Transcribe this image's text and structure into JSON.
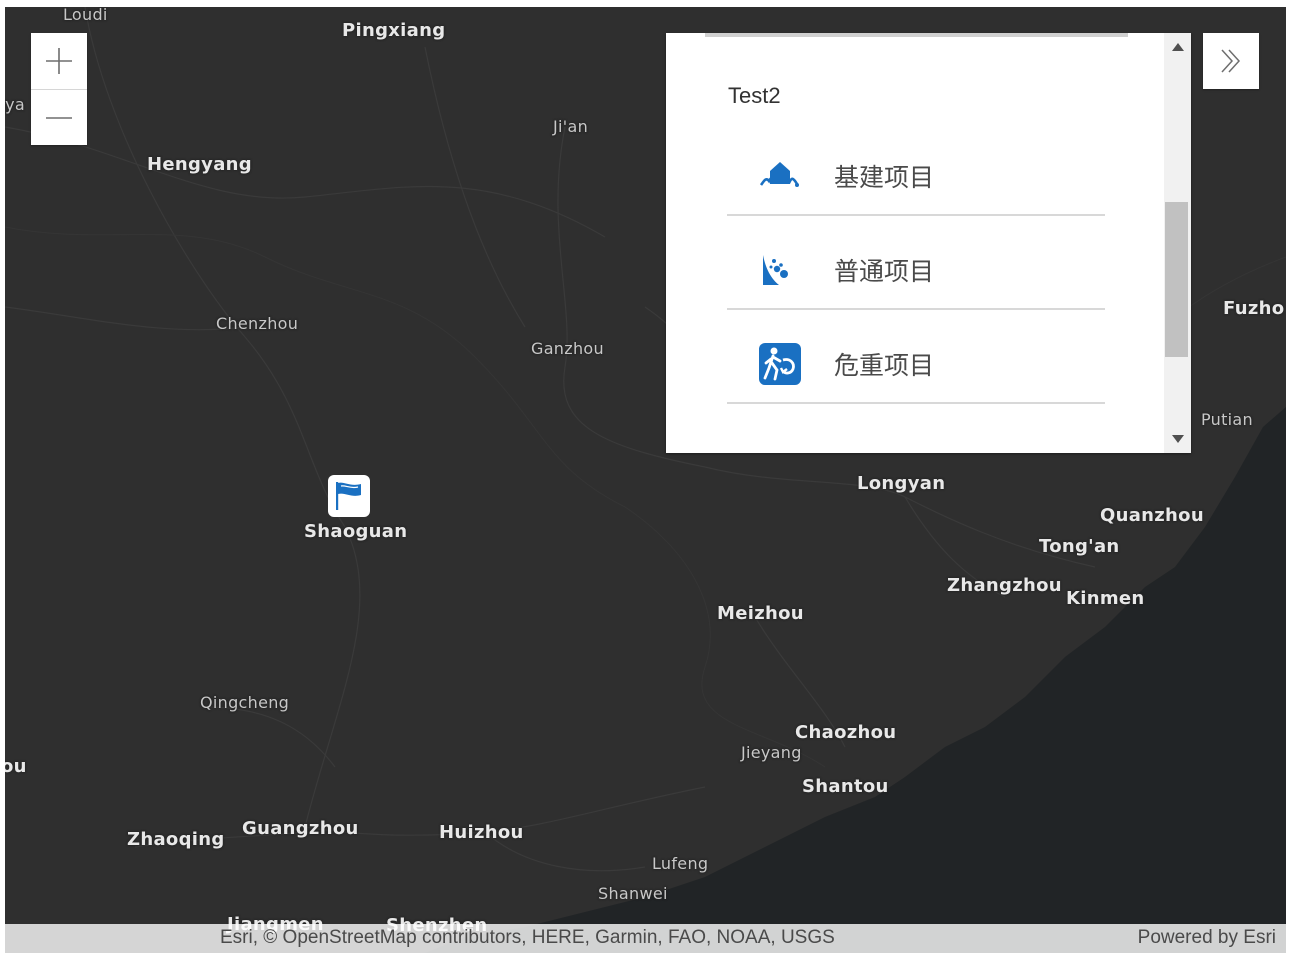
{
  "map": {
    "places": [
      {
        "id": "loudi",
        "name": "Loudi",
        "major": false
      },
      {
        "id": "pingxiang",
        "name": "Pingxiang",
        "major": true
      },
      {
        "id": "ya",
        "name": "oya",
        "major": false
      },
      {
        "id": "jian",
        "name": "Ji'an",
        "major": false
      },
      {
        "id": "hengyang",
        "name": "Hengyang",
        "major": true
      },
      {
        "id": "chenzhou",
        "name": "Chenzhou",
        "major": false
      },
      {
        "id": "ganzhou",
        "name": "Ganzhou",
        "major": false
      },
      {
        "id": "fuzhou",
        "name": "Fuzho",
        "major": true
      },
      {
        "id": "putian",
        "name": "Putian",
        "major": false
      },
      {
        "id": "longyan",
        "name": "Longyan",
        "major": true
      },
      {
        "id": "shaoguan",
        "name": "Shaoguan",
        "major": true
      },
      {
        "id": "quanzhou",
        "name": "Quanzhou",
        "major": true
      },
      {
        "id": "tongan",
        "name": "Tong'an",
        "major": true
      },
      {
        "id": "zhangzhou",
        "name": "Zhangzhou",
        "major": true
      },
      {
        "id": "kinmen",
        "name": "Kinmen",
        "major": true
      },
      {
        "id": "meizhou",
        "name": "Meizhou",
        "major": true
      },
      {
        "id": "qingcheng",
        "name": "Qingcheng",
        "major": false
      },
      {
        "id": "ou",
        "name": "ou",
        "major": true
      },
      {
        "id": "chaozhou",
        "name": "Chaozhou",
        "major": true
      },
      {
        "id": "jieyang",
        "name": "Jieyang",
        "major": false
      },
      {
        "id": "shantou",
        "name": "Shantou",
        "major": true
      },
      {
        "id": "zhaoqing",
        "name": "Zhaoqing",
        "major": true
      },
      {
        "id": "guangzhou",
        "name": "Guangzhou",
        "major": true
      },
      {
        "id": "huizhou",
        "name": "Huizhou",
        "major": true
      },
      {
        "id": "lufeng",
        "name": "Lufeng",
        "major": false
      },
      {
        "id": "shanwei",
        "name": "Shanwei",
        "major": false
      },
      {
        "id": "jiangmen",
        "name": "Jiangmen",
        "major": true
      },
      {
        "id": "shenzhen",
        "name": "Shenzhen",
        "major": true
      }
    ],
    "land_color": "#2f2f2f",
    "sea_color": "#212426",
    "marker_icon": "flag-icon"
  },
  "zoom": {
    "in_icon": "plus-icon",
    "out_icon": "minus-icon"
  },
  "expand": {
    "icon": "double-chevron-right-icon"
  },
  "legend": {
    "layer_title": "Test2",
    "items": [
      {
        "label": "基建项目",
        "icon": "flood-house-icon"
      },
      {
        "label": "普通项目",
        "icon": "landslide-icon"
      },
      {
        "label": "危重项目",
        "icon": "person-running-icon"
      }
    ],
    "accent_color": "#1a70c2"
  },
  "attribution": {
    "text": "Esri, © OpenStreetMap contributors, HERE, Garmin, FAO, NOAA, USGS",
    "powered": "Powered by Esri"
  }
}
